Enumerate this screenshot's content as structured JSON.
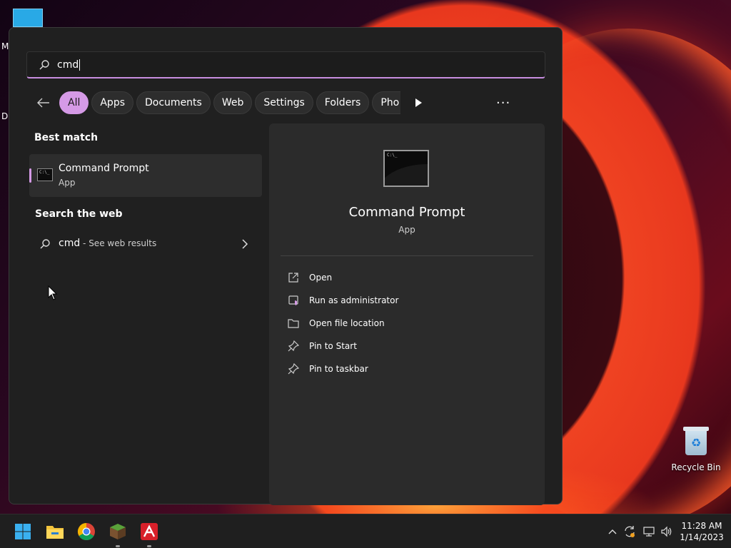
{
  "desktop": {
    "left_letters": [
      "M",
      "Da"
    ],
    "recycle_bin_label": "Recycle Bin"
  },
  "search": {
    "query": "cmd",
    "filters": [
      "All",
      "Apps",
      "Documents",
      "Web",
      "Settings",
      "Folders",
      "Pho"
    ],
    "active_filter": "All"
  },
  "results": {
    "best_match_title": "Best match",
    "best_match": {
      "name": "Command Prompt",
      "type": "App"
    },
    "web_title": "Search the web",
    "web_query": "cmd",
    "web_hint": " - See web results"
  },
  "detail": {
    "name": "Command Prompt",
    "type": "App",
    "actions": [
      "Open",
      "Run as administrator",
      "Open file location",
      "Pin to Start",
      "Pin to taskbar"
    ]
  },
  "taskbar": {
    "time": "11:28 AM",
    "date": "1/14/2023"
  },
  "colors": {
    "accent": "#d59ae6",
    "panel": "#202020",
    "detail": "#2b2b2b",
    "taskbar": "#1f1f1f"
  }
}
